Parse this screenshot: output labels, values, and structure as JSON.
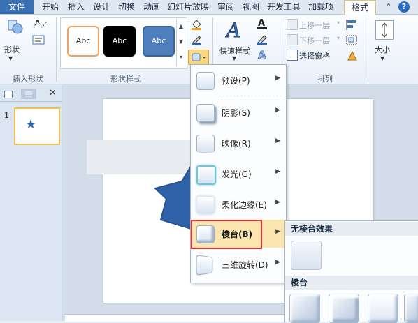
{
  "tabs": {
    "file": "文件",
    "start": "开始",
    "insert": "插入",
    "design": "设计",
    "transition": "切换",
    "animation": "动画",
    "slideshow": "幻灯片放映",
    "review": "审阅",
    "view": "视图",
    "developer": "开发工具",
    "addins": "加载项",
    "format": "格式"
  },
  "ribbon": {
    "shapes_label": "形状",
    "insert_shapes_group": "插入形状",
    "style_sample_1": "Abc",
    "style_sample_2": "Abc",
    "style_sample_3": "Abc",
    "shape_styles_group": "形状样式",
    "quick_styles": "快速样式",
    "bring_forward": "上移一层",
    "send_backward": "下移一层",
    "selection_pane": "选择窗格",
    "arrange_group": "排列",
    "size_label": "大小"
  },
  "left_pane": {
    "slide_number": "1"
  },
  "effects_menu": {
    "items": [
      {
        "label": "预设(P)"
      },
      {
        "label": "阴影(S)"
      },
      {
        "label": "映像(R)"
      },
      {
        "label": "发光(G)"
      },
      {
        "label": "柔化边缘(E)"
      },
      {
        "label": "棱台(B)"
      },
      {
        "label": "三维旋转(D)"
      }
    ]
  },
  "bevel_submenu": {
    "no_bevel_header": "无棱台效果",
    "bevel_header": "棱台"
  },
  "colors": {
    "accent": "#3a6fb0",
    "highlight_border": "#e03030",
    "highlight_fill": "#fbe6b2",
    "star_blue": "#2f62a8"
  }
}
